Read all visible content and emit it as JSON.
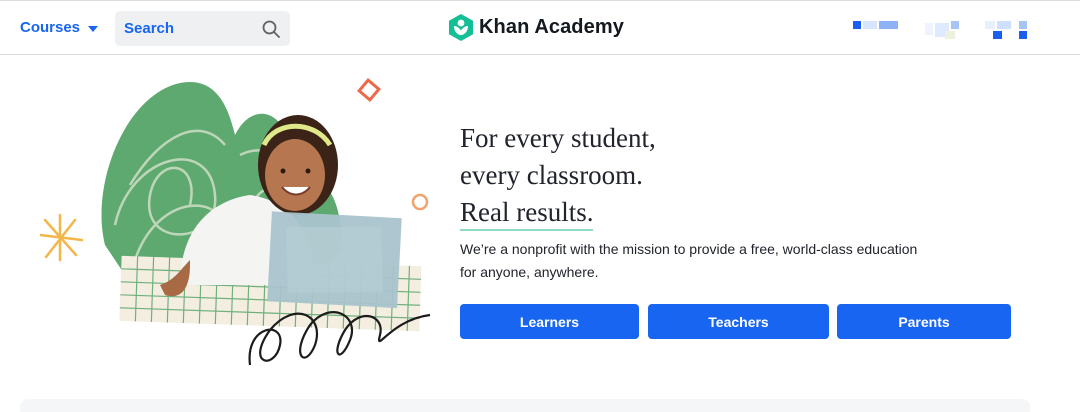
{
  "header": {
    "courses_label": "Courses",
    "search_label": "Search",
    "brand_name": "Khan Academy",
    "icons": {
      "courses": "chevron-down-icon",
      "search": "search-icon",
      "logo": "khan-academy-logo-icon"
    },
    "colors": {
      "accent": "#1865f2",
      "logo_green": "#14bf96"
    }
  },
  "hero": {
    "headline": {
      "line1": "For every student,",
      "line2": "every classroom.",
      "line3": "Real results."
    },
    "subtitle_line1": "We’re a nonprofit with the mission to provide a free, world-class education",
    "subtitle_line2": "for anyone, anywhere.",
    "buttons": [
      {
        "label": "Learners"
      },
      {
        "label": "Teachers"
      },
      {
        "label": "Parents"
      }
    ]
  }
}
